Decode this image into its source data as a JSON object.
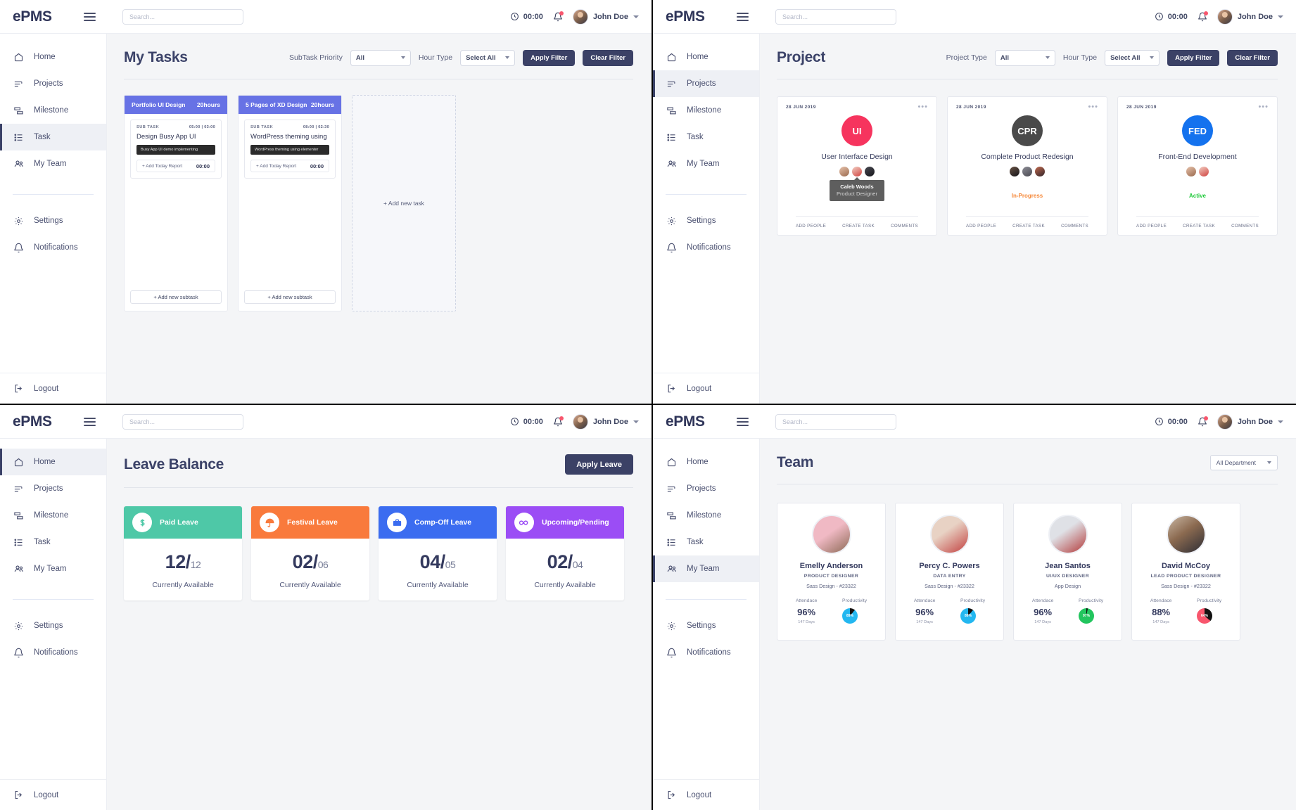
{
  "brand": "ePMS",
  "topbar": {
    "search_placeholder": "Search...",
    "clock": "00:00",
    "user": "John Doe"
  },
  "nav": {
    "home": "Home",
    "projects": "Projects",
    "milestone": "Milestone",
    "task": "Task",
    "my_team": "My Team",
    "settings": "Settings",
    "notifications": "Notifications",
    "logout": "Logout"
  },
  "tasks_page": {
    "title": "My Tasks",
    "filter_label_priority": "SubTask Priority",
    "priority_value": "All",
    "filter_label_hour": "Hour Type",
    "hour_value": "Select All",
    "apply": "Apply Filter",
    "clear": "Clear Filter",
    "add_new_task": "+ Add new task",
    "add_new_subtask": "+ Add new subtask",
    "columns": [
      {
        "title": "Portfolio UI Design",
        "hours": "20hours",
        "subtask_label": "SUB TASK",
        "time": "05:00 | 03:00",
        "subtask_title": "Design Busy App UI",
        "chip": "Busy App UI demo implementing",
        "report_label": "+ Add Today Report",
        "report_time": "00:00"
      },
      {
        "title": "5 Pages of XD Design",
        "hours": "20hours",
        "subtask_label": "SUB TASK",
        "time": "08:00 | 02:30",
        "subtask_title": "WordPress theming using",
        "chip": "WordPress theming using elementer",
        "report_label": "+ Add Today Report",
        "report_time": "00:00"
      }
    ]
  },
  "project_page": {
    "title": "Project",
    "filter_label_type": "Project Type",
    "type_value": "All",
    "filter_label_hour": "Hour Type",
    "hour_value": "Select All",
    "apply": "Apply Filter",
    "clear": "Clear Filter",
    "foot_add_people": "ADD PEOPLE",
    "foot_create_task": "CREATE TASK",
    "foot_comments": "COMMENTS",
    "tooltip": {
      "name": "Caleb Woods",
      "role": "Product Designer"
    },
    "cards": [
      {
        "date": "28 JUN 2019",
        "initials": "UI",
        "color": "#f6345e",
        "name": "User Interface Design",
        "status": "",
        "status_color": "#f68a3c",
        "avatars": 3
      },
      {
        "date": "28 JUN 2019",
        "initials": "CPR",
        "color": "#4a4a4a",
        "name": "Complete Product Redesign",
        "status": "In-Progress",
        "status_color": "#f68a3c",
        "avatars": 3
      },
      {
        "date": "28 JUN 2019",
        "initials": "FED",
        "color": "#1472ee",
        "name": "Front-End Development",
        "status": "Active",
        "status_color": "#1fc93a",
        "avatars": 2
      }
    ]
  },
  "leave_page": {
    "title": "Leave Balance",
    "apply_leave": "Apply Leave",
    "cards": [
      {
        "label": "Paid Leave",
        "used": "12",
        "total": "12",
        "sub": "Currently Available",
        "color": "#4ec8a7",
        "icon": "dollar-icon"
      },
      {
        "label": "Festival Leave",
        "used": "02",
        "total": "06",
        "sub": "Currently Available",
        "color": "#f97a3c",
        "icon": "umbrella-icon"
      },
      {
        "label": "Comp-Off Leave",
        "used": "04",
        "total": "05",
        "sub": "Currently Available",
        "color": "#3b6cf0",
        "icon": "briefcase-icon"
      },
      {
        "label": "Upcoming/Pending",
        "used": "02",
        "total": "04",
        "sub": "Currently Available",
        "color": "#9b4df5",
        "icon": "infinity-icon"
      }
    ]
  },
  "team_page": {
    "title": "Team",
    "department": "All Department",
    "attendance_label": "Attendace",
    "productivity_label": "Productivity",
    "members": [
      {
        "name": "Emelly Anderson",
        "role": "PRODUCT DESIGNER",
        "project": "Sass Design - #23322",
        "attendance": "96%",
        "days": "147 Days",
        "productivity": "89%",
        "prod_color": "#23b7f0",
        "photo_a": "#f0b9c4",
        "photo_b": "#8d6a56"
      },
      {
        "name": "Percy C. Powers",
        "role": "DATA ENTRY",
        "project": "Sass Design - #23322",
        "attendance": "96%",
        "days": "147 Days",
        "productivity": "89%",
        "prod_color": "#23b7f0",
        "photo_a": "#e8d2c4",
        "photo_b": "#c2403f"
      },
      {
        "name": "Jean Santos",
        "role": "UI/UX DESIGNER",
        "project": "App Design",
        "attendance": "96%",
        "days": "147 Days",
        "productivity": "97%",
        "prod_color": "#22c55e",
        "photo_a": "#dfe1e6",
        "photo_b": "#b33a3a"
      },
      {
        "name": "David McCoy",
        "role": "LEAD PRODUCT DESIGNER",
        "project": "Sass Design - #23322",
        "attendance": "88%",
        "days": "147 Days",
        "productivity": "64%",
        "prod_color": "#f8566d",
        "photo_a": "#c9b7a4",
        "photo_b": "#2d2d35"
      }
    ]
  }
}
